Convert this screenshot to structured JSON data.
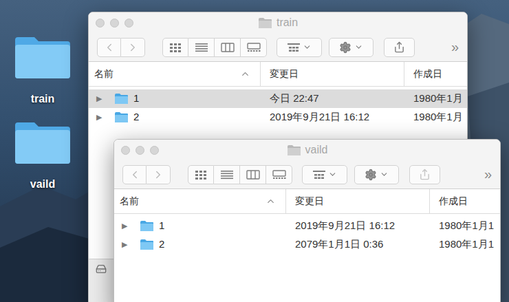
{
  "desktop": {
    "icons": [
      {
        "label": "train"
      },
      {
        "label": "vaild"
      }
    ]
  },
  "windows": [
    {
      "title": "train",
      "back_enabled": false,
      "forward_enabled": false,
      "share_enabled": true,
      "overflow": "»",
      "view_modes": [
        {
          "kind": "icons",
          "selected": false
        },
        {
          "kind": "list",
          "selected": true
        },
        {
          "kind": "columns",
          "selected": false
        },
        {
          "kind": "gallery",
          "selected": false
        }
      ],
      "columns": [
        {
          "label": "名前",
          "sorted": true
        },
        {
          "label": "変更日",
          "sorted": false
        },
        {
          "label": "作成日",
          "sorted": false
        }
      ],
      "rows": [
        {
          "disclosure": "▶",
          "name": "1",
          "modified": "今日 22:47",
          "created": "1980年1月",
          "expanded": false,
          "selected": true
        },
        {
          "disclosure": "▶",
          "name": "2",
          "modified": "2019年9月21日 16:12",
          "created": "1980年1月",
          "expanded": false,
          "selected": false
        }
      ]
    },
    {
      "title": "vaild",
      "back_enabled": false,
      "forward_enabled": false,
      "share_enabled": false,
      "overflow": "»",
      "view_modes": [
        {
          "kind": "icons",
          "selected": false
        },
        {
          "kind": "list",
          "selected": true
        },
        {
          "kind": "columns",
          "selected": false
        },
        {
          "kind": "gallery",
          "selected": false
        }
      ],
      "columns": [
        {
          "label": "名前",
          "sorted": true
        },
        {
          "label": "変更日",
          "sorted": false
        },
        {
          "label": "作成日",
          "sorted": false
        }
      ],
      "rows": [
        {
          "disclosure": "▶",
          "name": "1",
          "modified": "2019年9月21日 16:12",
          "created": "1980年1月1",
          "expanded": false,
          "selected": false
        },
        {
          "disclosure": "▶",
          "name": "2",
          "modified": "2079年1月1日 0:36",
          "created": "1980年1月1",
          "expanded": false,
          "selected": false
        }
      ]
    }
  ]
}
